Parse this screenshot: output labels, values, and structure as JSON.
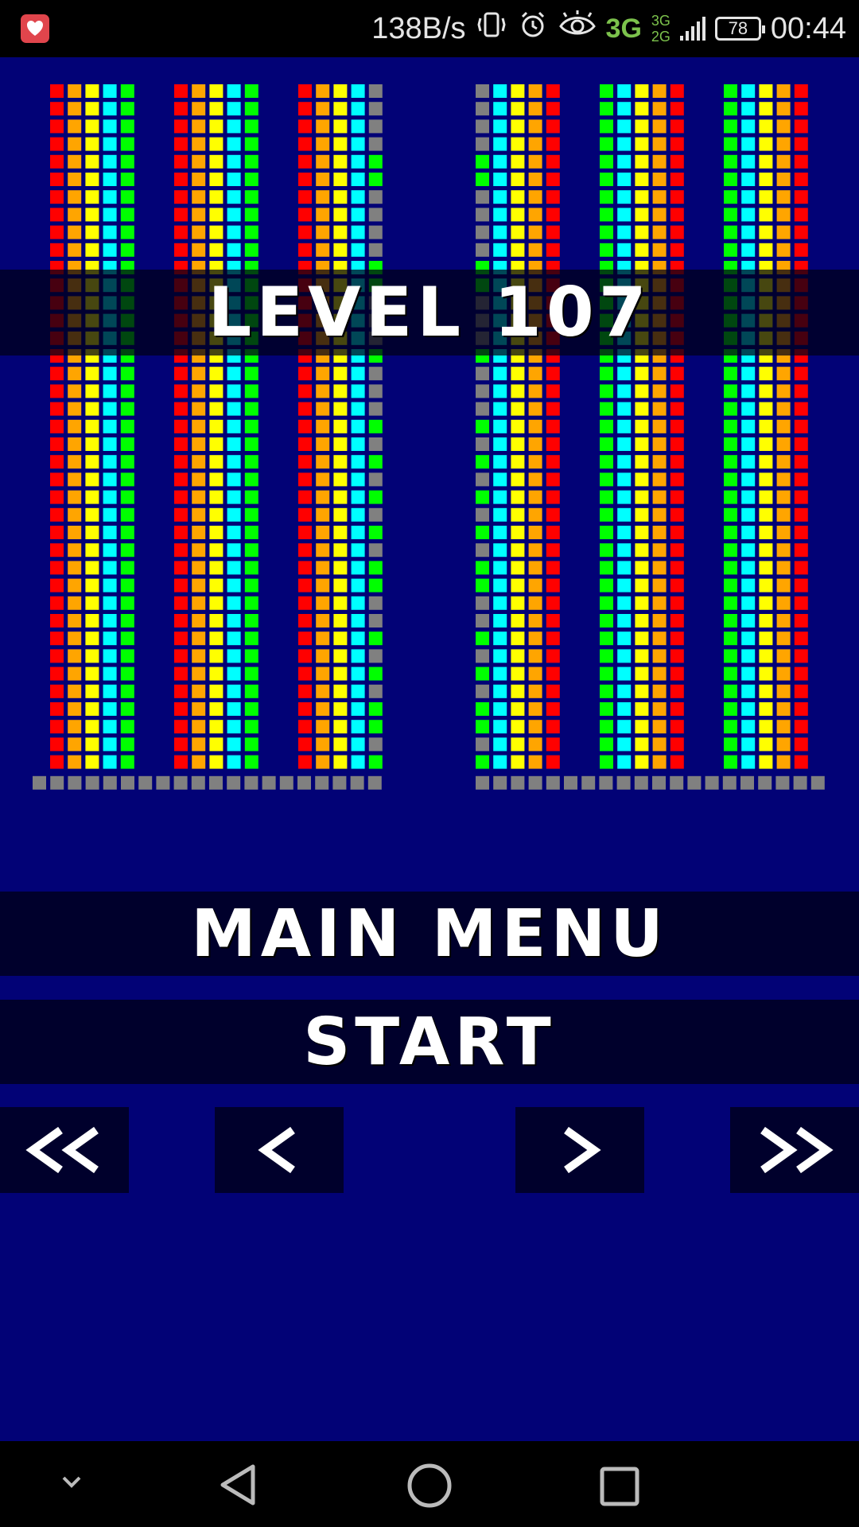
{
  "status_bar": {
    "app_icon": "heart-shield-icon",
    "net_speed": "138B/s",
    "network_primary": "3G",
    "network_secondary": [
      "3G",
      "2G"
    ],
    "battery": "78",
    "time": "00:44",
    "icons": [
      "vibrate-icon",
      "alarm-icon",
      "eye-icon",
      "signal-icon",
      "battery-icon"
    ]
  },
  "game": {
    "level_label": "LEVEL 107",
    "main_menu_label": "MAIN MENU",
    "start_label": "START",
    "nav": {
      "first_icon": "double-chevron-left-icon",
      "prev_icon": "chevron-left-icon",
      "next_icon": "chevron-right-icon",
      "last_icon": "double-chevron-right-icon"
    },
    "colors": {
      "background": "#020276",
      "red": "#ff0000",
      "orange": "#ffa500",
      "yellow": "#ffff00",
      "cyan": "#00ffff",
      "green": "#00ff00",
      "gray": "#808080",
      "bar": "#00002c"
    },
    "stack_rows": 39,
    "tubes_left": [
      [
        "red",
        "orange",
        "yellow",
        "cyan",
        "green"
      ],
      [
        "red",
        "orange",
        "yellow",
        "cyan",
        "green"
      ],
      [
        "red",
        "orange",
        "yellow",
        "cyan",
        "mixed"
      ]
    ],
    "tubes_right": [
      [
        "mixed",
        "cyan",
        "yellow",
        "orange",
        "red"
      ],
      [
        "green",
        "cyan",
        "yellow",
        "orange",
        "red"
      ],
      [
        "green",
        "cyan",
        "yellow",
        "orange",
        "red"
      ]
    ],
    "mixed_column_pattern": "GGGGXXGGGGXXGGGXGGGXGXGXGXGXXGGXGXGXXGX",
    "gray_base": "left and right floor rows"
  },
  "nav_bar": {
    "icons": [
      "collapse-chevron-icon",
      "back-icon",
      "home-icon",
      "recents-icon"
    ]
  }
}
